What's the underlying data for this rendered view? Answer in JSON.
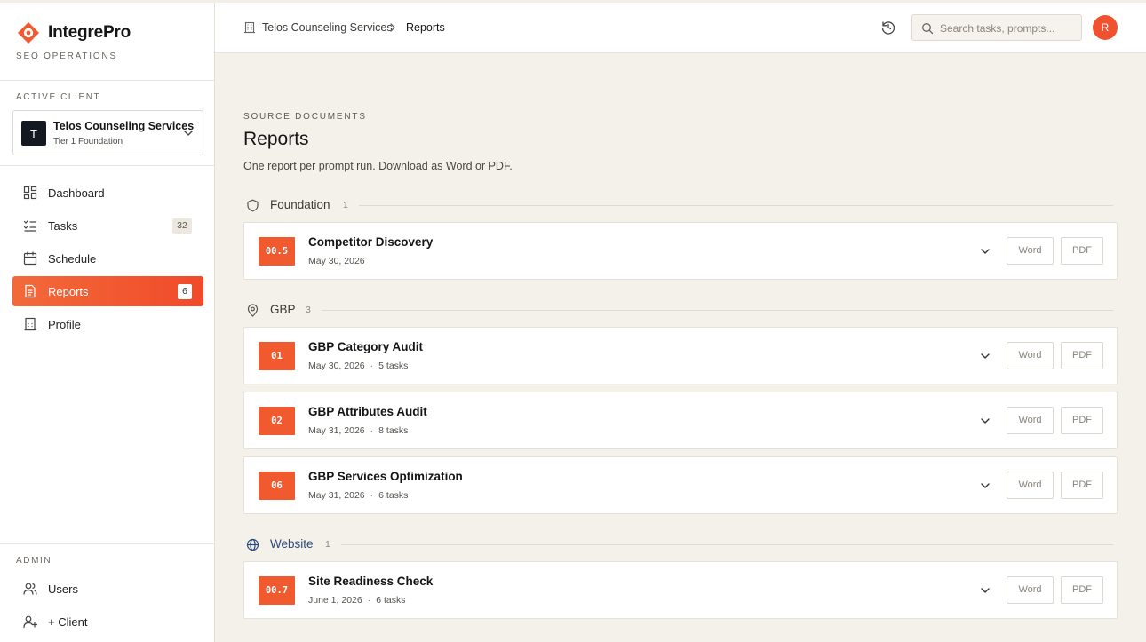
{
  "brand": {
    "name": "IntegrePro",
    "subtitle": "SEO OPERATIONS"
  },
  "sidebar": {
    "active_client_label": "ACTIVE CLIENT",
    "client": {
      "initial": "T",
      "name": "Telos Counseling Services",
      "tier": "Tier 1 Foundation"
    },
    "nav": [
      {
        "label": "Dashboard",
        "icon": "dashboard-icon"
      },
      {
        "label": "Tasks",
        "icon": "tasks-icon",
        "count": "32"
      },
      {
        "label": "Schedule",
        "icon": "calendar-icon"
      },
      {
        "label": "Reports",
        "icon": "report-icon",
        "count": "6",
        "active": true
      },
      {
        "label": "Profile",
        "icon": "building-icon"
      }
    ],
    "admin_label": "ADMIN",
    "admin": [
      {
        "label": "Users",
        "icon": "users-icon"
      },
      {
        "label": "+ Client",
        "icon": "add-user-icon"
      }
    ]
  },
  "header": {
    "breadcrumb_client": "Telos Counseling Services",
    "breadcrumb_current": "Reports",
    "search_placeholder": "Search tasks, prompts...",
    "user_initial": "R"
  },
  "main": {
    "eyebrow": "SOURCE DOCUMENTS",
    "title": "Reports",
    "subtitle": "One report per prompt run. Download as Word or PDF.",
    "groups": [
      {
        "name": "Foundation",
        "count": "1",
        "icon": "shield-icon",
        "accent": "#3c3a36",
        "reports": [
          {
            "code": "00.5",
            "title": "Competitor Discovery",
            "date": "May 30, 2026",
            "tasks": ""
          }
        ]
      },
      {
        "name": "GBP",
        "count": "3",
        "icon": "map-pin-icon",
        "accent": "#3c3a36",
        "reports": [
          {
            "code": "01",
            "title": "GBP Category Audit",
            "date": "May 30, 2026",
            "tasks": "5 tasks"
          },
          {
            "code": "02",
            "title": "GBP Attributes Audit",
            "date": "May 31, 2026",
            "tasks": "8 tasks"
          },
          {
            "code": "06",
            "title": "GBP Services Optimization",
            "date": "May 31, 2026",
            "tasks": "6 tasks"
          }
        ]
      },
      {
        "name": "Website",
        "count": "1",
        "icon": "globe-icon",
        "accent": "#2d4a7a",
        "reports": [
          {
            "code": "00.7",
            "title": "Site Readiness Check",
            "date": "June 1, 2026",
            "tasks": "6 tasks"
          }
        ]
      }
    ],
    "word_label": "Word",
    "pdf_label": "PDF"
  },
  "colors": {
    "accent": "#f15a2e",
    "active_nav": "#f04a2a",
    "background": "#f4f0ea"
  }
}
